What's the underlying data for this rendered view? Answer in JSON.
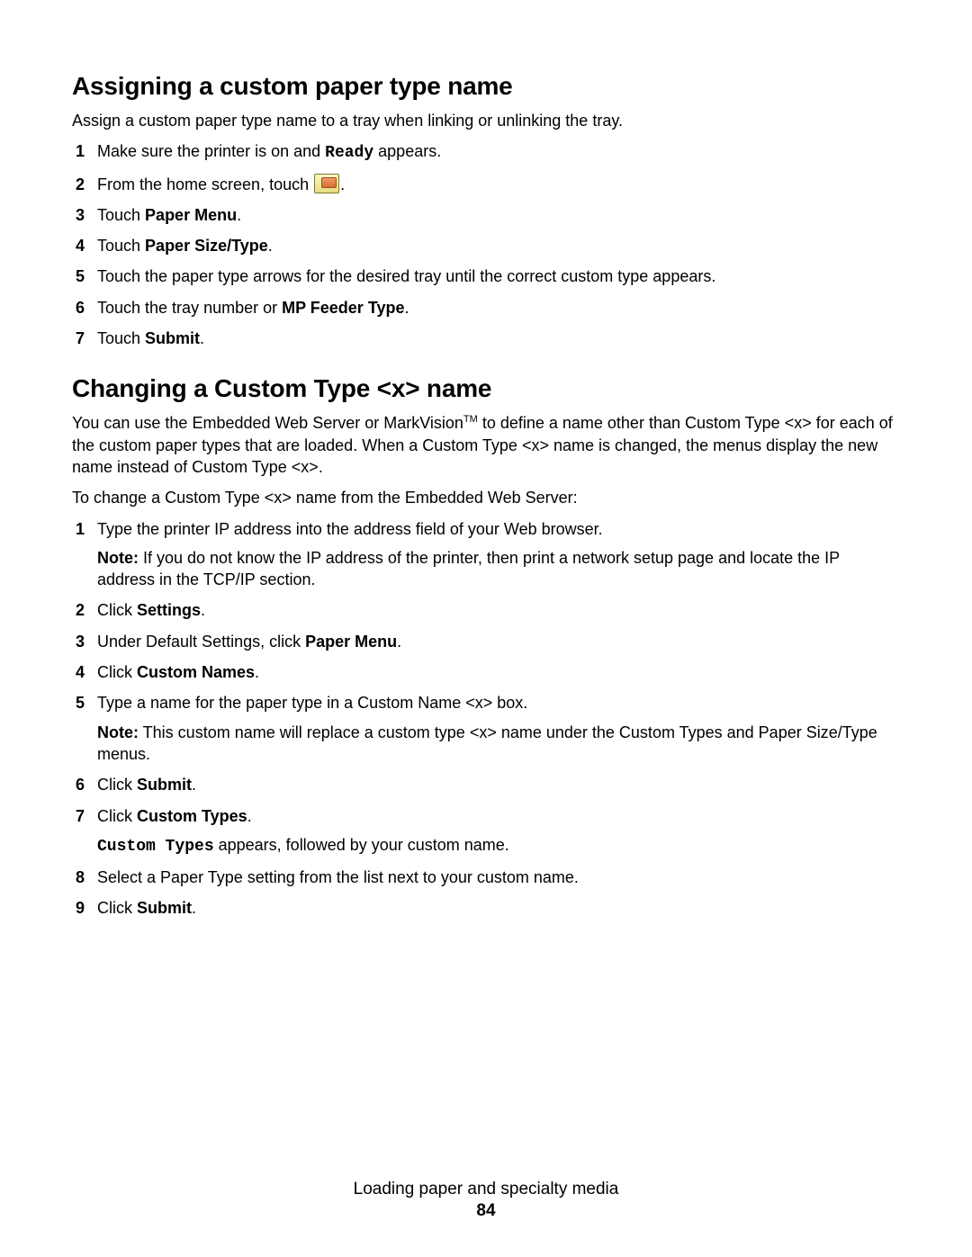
{
  "section1": {
    "heading": "Assigning a custom paper type name",
    "intro": "Assign a custom paper type name to a tray when linking or unlinking the tray.",
    "steps": {
      "s1_a": "Make sure the printer is on and ",
      "s1_ready": "Ready",
      "s1_b": " appears.",
      "s2_a": "From the home screen, touch ",
      "s2_b": ".",
      "s3_a": "Touch ",
      "s3_bold": "Paper Menu",
      "s3_b": ".",
      "s4_a": "Touch ",
      "s4_bold": "Paper Size/Type",
      "s4_b": ".",
      "s5": "Touch the paper type arrows for the desired tray until the correct custom type appears.",
      "s6_a": "Touch the tray number or ",
      "s6_bold": "MP Feeder Type",
      "s6_b": ".",
      "s7_a": "Touch ",
      "s7_bold": "Submit",
      "s7_b": "."
    }
  },
  "section2": {
    "heading": "Changing a Custom Type <x> name",
    "intro_a": "You can use the Embedded Web Server or MarkVision",
    "intro_tm": "TM",
    "intro_b": " to define a name other than Custom Type <x> for each of the custom paper types that are loaded. When a Custom Type <x> name is changed, the menus display the new name instead of Custom Type <x>.",
    "intro2": "To change a Custom Type <x> name from the Embedded Web Server:",
    "steps": {
      "s1": "Type the printer IP address into the address field of your Web browser.",
      "s1_note_label": "Note:",
      "s1_note": " If you do not know the IP address of the printer, then print a network setup page and locate the IP address in the TCP/IP section.",
      "s2_a": "Click ",
      "s2_bold": "Settings",
      "s2_b": ".",
      "s3_a": "Under Default Settings, click ",
      "s3_bold": "Paper Menu",
      "s3_b": ".",
      "s4_a": "Click ",
      "s4_bold": "Custom Names",
      "s4_b": ".",
      "s5": "Type a name for the paper type in a Custom Name <x> box.",
      "s5_note_label": "Note:",
      "s5_note": " This custom name will replace a custom type <x> name under the Custom Types and Paper Size/Type menus.",
      "s6_a": "Click ",
      "s6_bold": "Submit",
      "s6_b": ".",
      "s7_a": "Click ",
      "s7_bold": "Custom Types",
      "s7_b": ".",
      "s7_sub_mono": "Custom Types",
      "s7_sub_rest": " appears, followed by your custom name.",
      "s8": "Select a Paper Type setting from the list next to your custom name.",
      "s9_a": "Click ",
      "s9_bold": "Submit",
      "s9_b": "."
    }
  },
  "footer": {
    "title": "Loading paper and specialty media",
    "page": "84"
  }
}
